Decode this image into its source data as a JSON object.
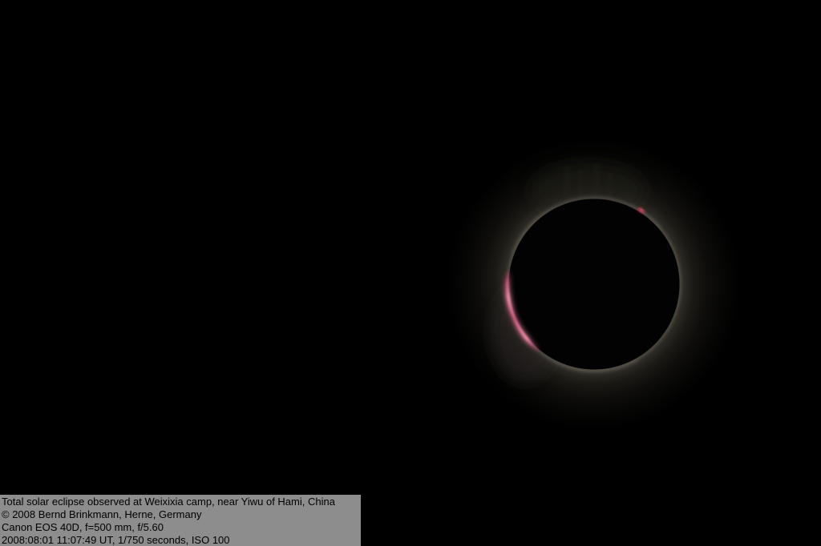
{
  "colors": {
    "background": "#000000",
    "caption_bg": "#8d8d8d",
    "caption_text": "#000000",
    "moon_disk": "#020202",
    "corona_limb": "#403d35",
    "chromosphere_pink": "#ef8ba7",
    "chromosphere_mid": "#d05a7e",
    "chromosphere_deep": "#a93056",
    "prominence_red": "#a62e44",
    "prominence_core": "#d4556e"
  },
  "caption": {
    "lines": [
      "Total solar eclipse observed at Weixixia camp, near Yiwu of Hami, China",
      "© 2008 Bernd Brinkmann, Herne, Germany",
      "Canon EOS 40D, f=500 mm, f/5.60",
      "2008:08:01 11:07:49 UT, 1/750 seconds, ISO 100"
    ]
  },
  "scene": {
    "description": "Total solar eclipse: dark lunar disk with faint corona glow, pink chromosphere arc on the lower-left limb and a small red prominence on the upper-right limb"
  }
}
